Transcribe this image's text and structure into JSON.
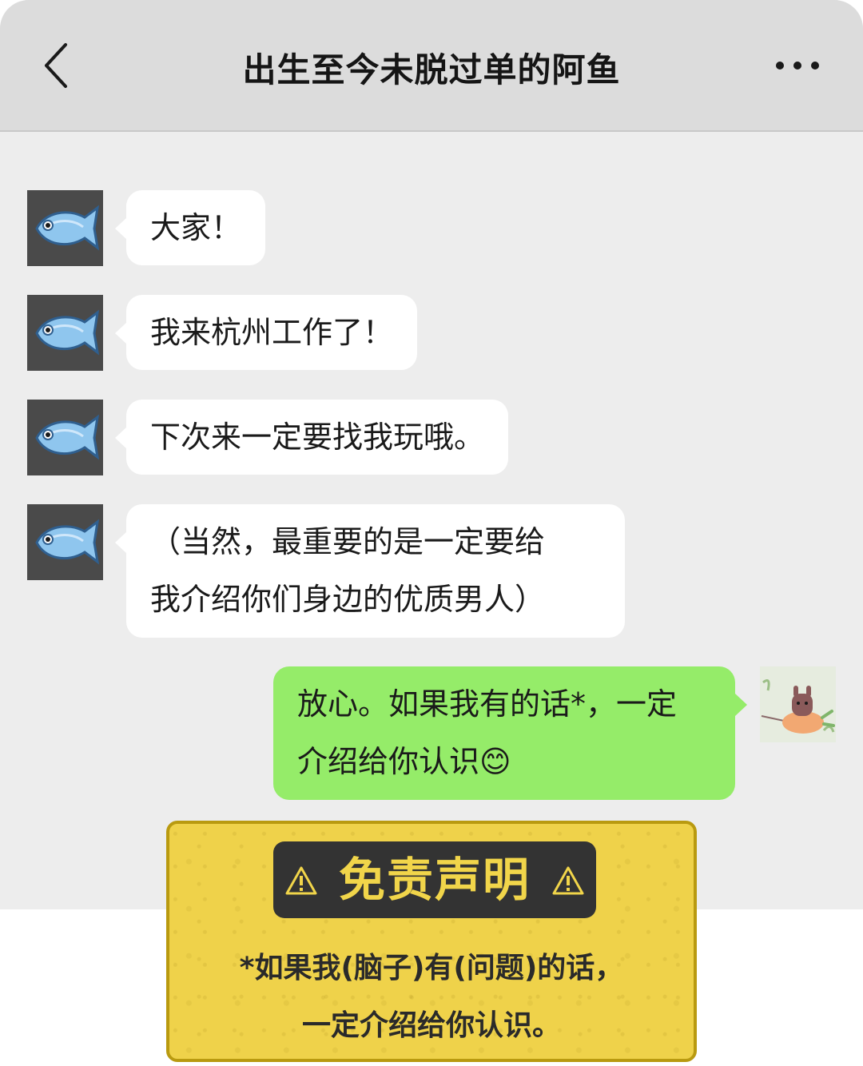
{
  "header": {
    "title": "出生至今未脱过单的阿鱼"
  },
  "messages": [
    {
      "from": "other",
      "avatar": "fish-emoji",
      "lines": [
        "大家！"
      ]
    },
    {
      "from": "other",
      "avatar": "fish-emoji",
      "lines": [
        "我来杭州工作了！"
      ]
    },
    {
      "from": "other",
      "avatar": "fish-emoji",
      "lines": [
        "下次来一定要找我玩哦。"
      ]
    },
    {
      "from": "other",
      "avatar": "fish-emoji",
      "lines": [
        "（当然，最重要的是一定要给",
        "我介绍你们身边的优质男人）"
      ]
    },
    {
      "from": "me",
      "avatar": "bunny-carrot-sticker",
      "lines": [
        "放心。如果我有的话*，一定",
        "介绍给你认识"
      ],
      "emoji": "😊"
    }
  ],
  "disclaimer": {
    "title": "免责声明",
    "icon": "warning-icon",
    "lines": [
      "*如果我(脑子)有(问题)的话，",
      "一定介绍给你认识。"
    ]
  },
  "colors": {
    "header_bg": "#dcdcdc",
    "chat_bg": "#ededed",
    "my_bubble": "#95ec69",
    "disclaimer_bg": "#efd24a"
  }
}
